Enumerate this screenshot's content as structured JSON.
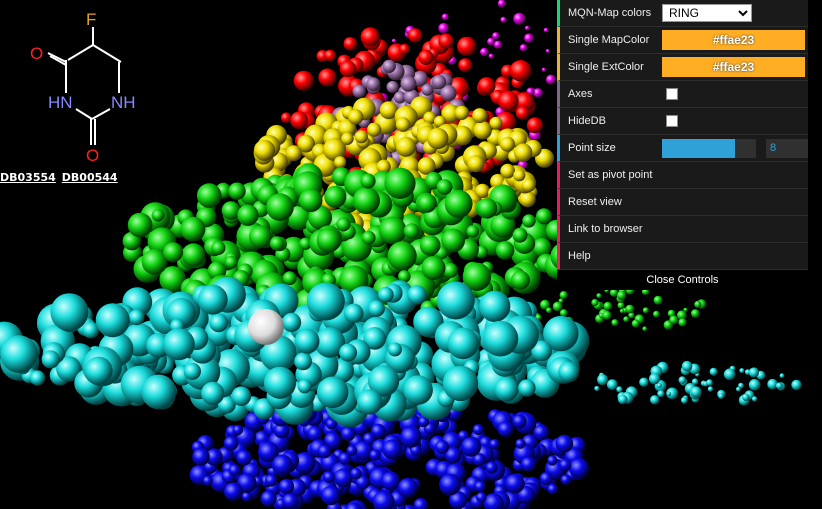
{
  "molecule": {
    "atoms": {
      "fluorine": "F",
      "oxygen_left": "O",
      "oxygen_bottom": "O",
      "nh_left": "HN",
      "nh_right": "NH"
    },
    "db_links": [
      "DB03554",
      "DB00544"
    ]
  },
  "controls": {
    "map_colors": {
      "label": "MQN-Map colors",
      "value": "RING"
    },
    "single_map_color": {
      "label": "Single MapColor",
      "value": "#ffae23"
    },
    "single_ext_color": {
      "label": "Single ExtColor",
      "value": "#ffae23"
    },
    "axes": {
      "label": "Axes",
      "checked": false
    },
    "hide_db": {
      "label": "HideDB",
      "checked": false
    },
    "point_size": {
      "label": "Point size",
      "value": "8",
      "fraction": 0.78
    },
    "pivot": {
      "label": "Set as pivot point"
    },
    "reset": {
      "label": "Reset view"
    },
    "link": {
      "label": "Link to browser"
    },
    "help": {
      "label": "Help"
    },
    "close": {
      "label": "Close Controls"
    }
  },
  "colors": {
    "red": "#ff0000",
    "magenta": "#ee00ee",
    "yellow": "#f0e000",
    "green": "#18d818",
    "cyan": "#20e0e0",
    "blue": "#1010ee",
    "purple": "#a070b0",
    "accent": "#ffae23"
  }
}
